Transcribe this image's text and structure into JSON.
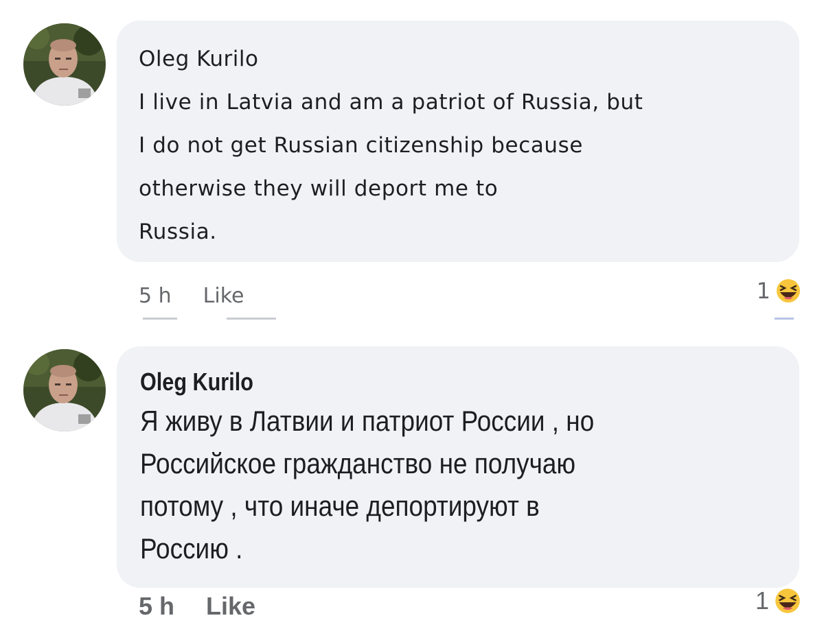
{
  "comments": [
    {
      "author": "Oleg Kurilo",
      "lines": [
        "I live in Latvia and am a patriot of Russia, but",
        "I do not get Russian citizenship because",
        "otherwise they will deport me to",
        "Russia."
      ],
      "time": "5 h",
      "like_label": "Like",
      "reaction_count": "1",
      "reaction_icon": "haha-emoji-icon"
    },
    {
      "author": "Oleg Kurilo",
      "lines": [
        "Я живу в Латвии и патриот России , но",
        "Российское гражданство не получаю",
        "потому , что иначе депортируют в",
        "Россию ."
      ],
      "time": "5 h",
      "like_label": "Like",
      "reaction_count": "1",
      "reaction_icon": "haha-emoji-icon"
    }
  ],
  "colors": {
    "bubble_bg": "#f0f2f5",
    "meta_text": "#65676b",
    "body_text": "#1c1e21",
    "haha_yellow": "#f7c63c"
  }
}
